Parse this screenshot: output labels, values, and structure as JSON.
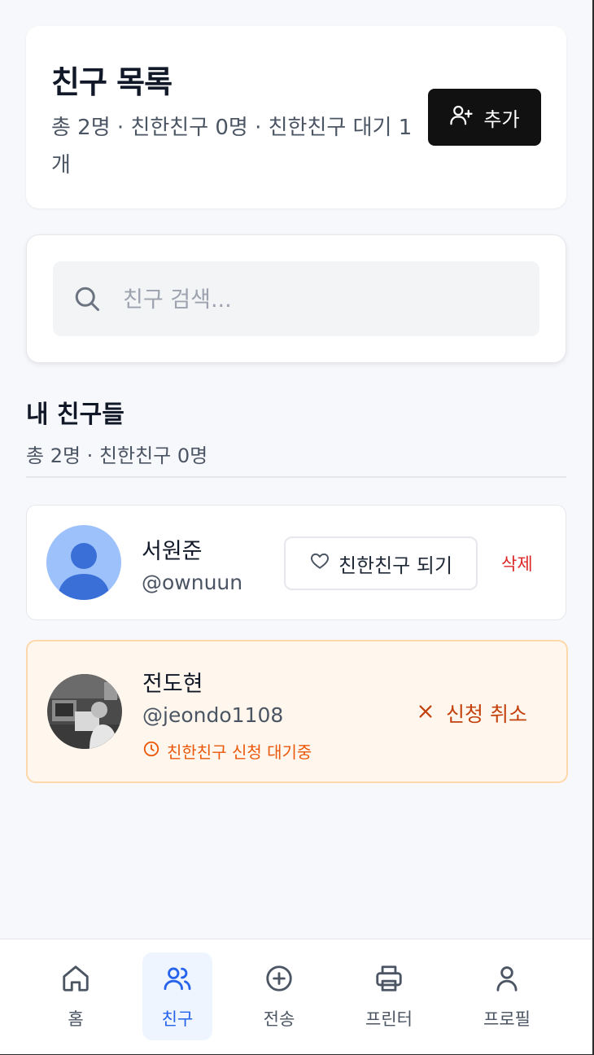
{
  "header": {
    "title": "친구 목록",
    "summary": "총 2명 · 친한친구 0명 · 친한친구 대기 1개",
    "add_button": "추가"
  },
  "search": {
    "placeholder": "친구 검색..."
  },
  "section": {
    "title": "내 친구들",
    "summary": "총 2명 · 친한친구 0명"
  },
  "friends": [
    {
      "name": "서원준",
      "handle": "@ownuun",
      "action": "친한친구 되기",
      "delete": "삭제"
    },
    {
      "name": "전도현",
      "handle": "@jeondo1108",
      "status": "친한친구 신청 대기중",
      "cancel": "신청 취소"
    }
  ],
  "nav": [
    {
      "label": "홈",
      "icon": "home-icon"
    },
    {
      "label": "친구",
      "icon": "users-icon",
      "active": true
    },
    {
      "label": "전송",
      "icon": "plus-circle-icon"
    },
    {
      "label": "프린터",
      "icon": "printer-icon"
    },
    {
      "label": "프로필",
      "icon": "user-icon"
    }
  ],
  "colors": {
    "accent": "#2563eb",
    "danger": "#dc2626",
    "pending": "#ea580c",
    "pending_bg": "#fff7ed"
  }
}
